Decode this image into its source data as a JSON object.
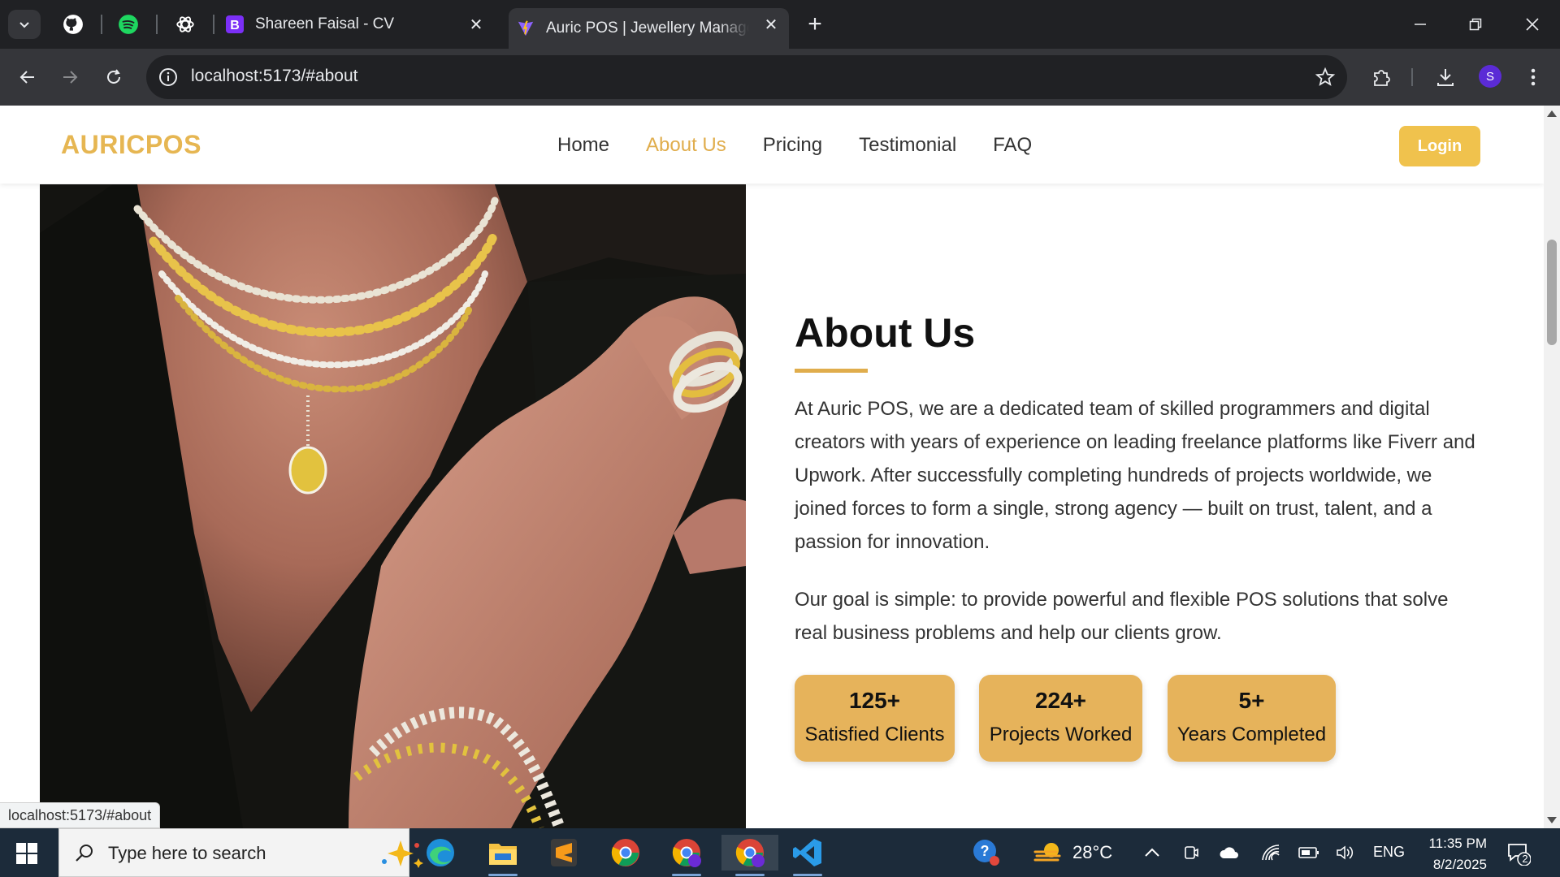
{
  "browser": {
    "tabs": [
      {
        "title": "Shareen Faisal - CV",
        "favicon": "bootstrap-icon"
      },
      {
        "title": "Auric POS | Jewellery Management",
        "favicon": "vite-icon"
      }
    ],
    "pinned": [
      "github-icon",
      "spotify-icon",
      "chatgpt-icon"
    ],
    "url": "localhost:5173/#about",
    "profile_initial": "S",
    "status_url": "localhost:5173/#about"
  },
  "site": {
    "logo": "AURICPOS",
    "nav": [
      {
        "label": "Home"
      },
      {
        "label": "About Us",
        "active": true
      },
      {
        "label": "Pricing"
      },
      {
        "label": "Testimonial"
      },
      {
        "label": "FAQ"
      }
    ],
    "login_label": "Login",
    "accent_color": "#e0ad4c"
  },
  "about": {
    "heading": "About Us",
    "paragraphs": [
      "At Auric POS, we are a dedicated team of skilled programmers and digital creators with years of experience on leading freelance platforms like Fiverr and Upwork. After successfully completing hundreds of projects worldwide, we joined forces to form a single, strong agency — built on trust, talent, and a passion for innovation.",
      "Our goal is simple: to provide powerful and flexible POS solutions that solve real business problems and help our clients grow."
    ],
    "stats": [
      {
        "value": "125+",
        "label": "Satisfied Clients"
      },
      {
        "value": "224+",
        "label": "Projects Worked"
      },
      {
        "value": "5+",
        "label": "Years Completed"
      }
    ]
  },
  "taskbar": {
    "search_placeholder": "Type here to search",
    "weather": "28°C",
    "language": "ENG",
    "time": "11:35 PM",
    "date": "8/2/2025",
    "notification_count": "2"
  }
}
